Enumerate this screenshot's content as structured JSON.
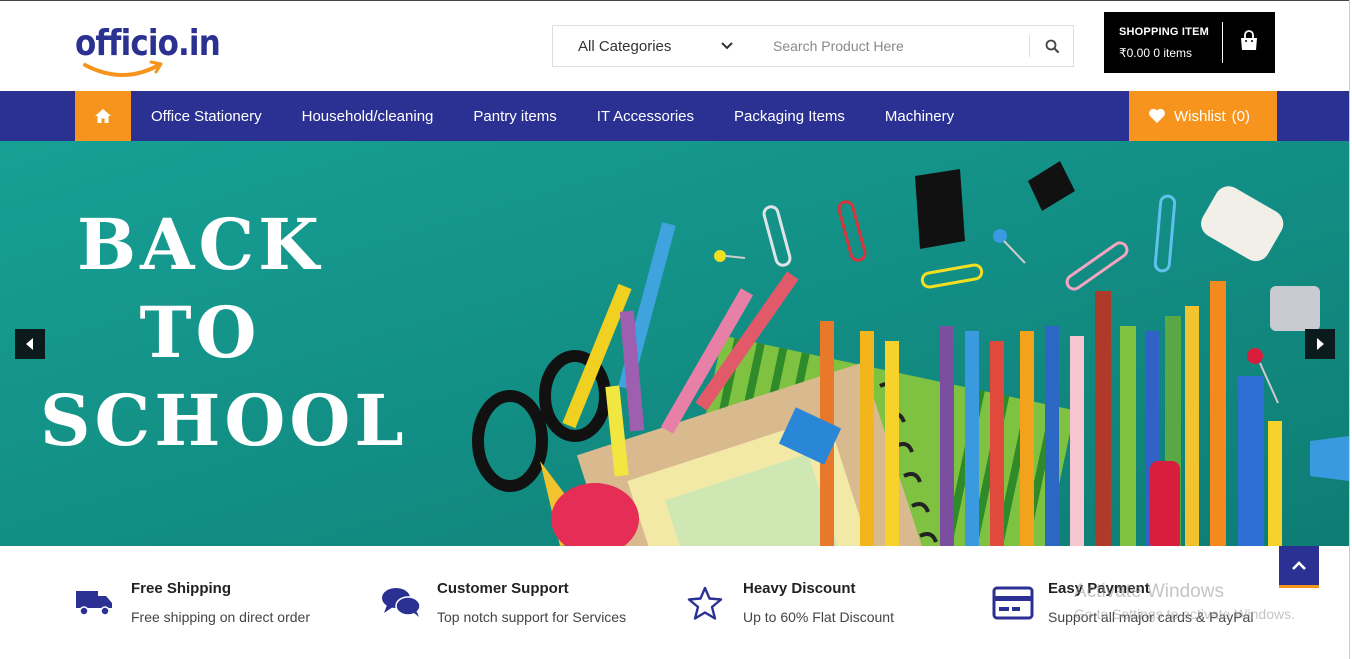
{
  "header": {
    "logo_text": "officio.in",
    "search": {
      "category_selected": "All Categories",
      "placeholder": "Search Product Here",
      "value": ""
    },
    "cart": {
      "title": "SHOPPING ITEM",
      "info": "₹0.00 0 items"
    }
  },
  "nav": {
    "items": [
      {
        "label": "Office Stationery"
      },
      {
        "label": "Household/cleaning"
      },
      {
        "label": "Pantry items"
      },
      {
        "label": "IT Accessories"
      },
      {
        "label": "Packaging Items"
      },
      {
        "label": "Machinery"
      }
    ],
    "wishlist_label": "Wishlist",
    "wishlist_count": "(0)"
  },
  "banner": {
    "line1": "BACK",
    "line2": "TO",
    "line3": "SCHOOL"
  },
  "features": [
    {
      "title": "Free Shipping",
      "desc": "Free shipping on direct order",
      "icon": "truck-icon"
    },
    {
      "title": "Customer Support",
      "desc": "Top notch support for Services",
      "icon": "chat-icon"
    },
    {
      "title": "Heavy Discount",
      "desc": "Up to 60% Flat Discount",
      "icon": "star-icon"
    },
    {
      "title": "Easy Payment",
      "desc": "Support all major cards & PayPal",
      "icon": "credit-card-icon"
    }
  ],
  "overlay": {
    "watermark_title": "Activate Windows",
    "watermark_sub": "Go to Settings to activate Windows."
  },
  "colors": {
    "brand_blue": "#2b3193",
    "accent_orange": "#f7941d",
    "banner_teal": "#14948a"
  }
}
